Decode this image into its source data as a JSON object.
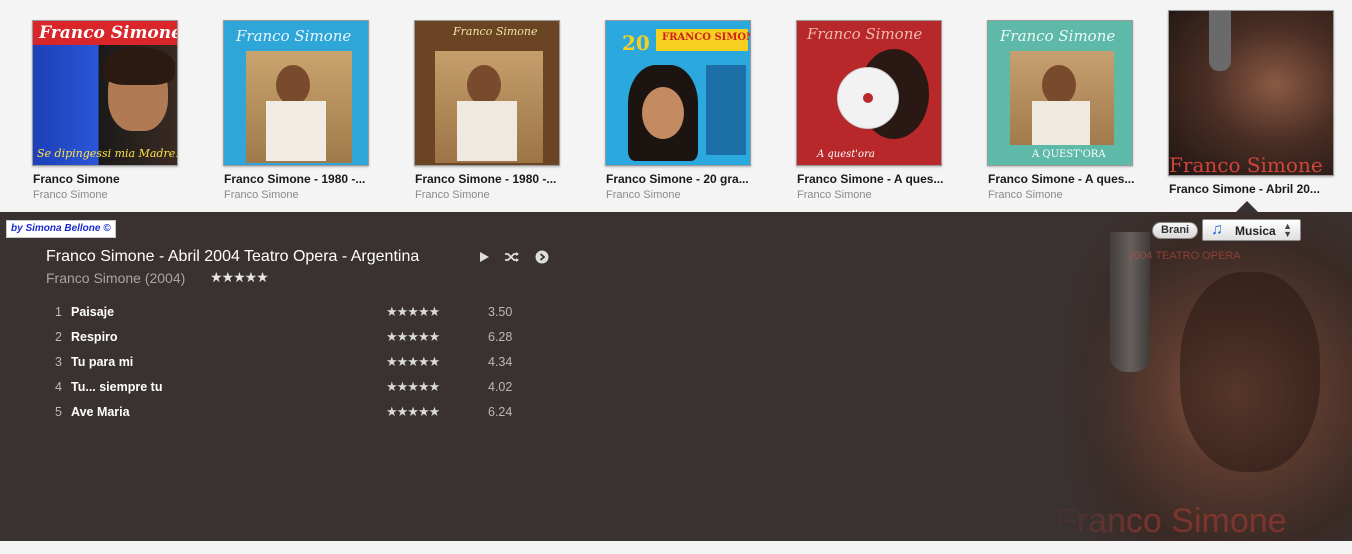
{
  "albums": [
    {
      "title": "Franco Simone",
      "artist": "Franco Simone",
      "cover_text": "Franco Simone",
      "cover_subtext": "Se dipingessi mia Madre..."
    },
    {
      "title": "Franco Simone - 1980 -...",
      "artist": "Franco Simone",
      "cover_text": "Franco Simone"
    },
    {
      "title": "Franco Simone - 1980 -...",
      "artist": "Franco Simone",
      "cover_text": "Franco Simone"
    },
    {
      "title": "Franco Simone - 20 gra...",
      "artist": "Franco Simone",
      "cover_text": "FRANCO SIMONE",
      "cover_badge": "20"
    },
    {
      "title": "Franco Simone - A ques...",
      "artist": "Franco Simone",
      "cover_text": "Franco Simone",
      "cover_subtext": "A quest'ora"
    },
    {
      "title": "Franco Simone - A ques...",
      "artist": "Franco Simone",
      "cover_text": "Franco Simone",
      "cover_subtext": "A QUEST'ORA"
    },
    {
      "title": "Franco Simone - Abril 20...",
      "artist": "",
      "cover_text": "Franco Simone"
    }
  ],
  "credit": "by Simona Bellone ©",
  "detail": {
    "title": "Franco Simone - Abril 2004 Teatro Opera - Argentina",
    "meta": "Franco Simone (2004)",
    "stars": "★★★★★",
    "play_icon": "play-icon",
    "shuffle_icon": "shuffle-icon",
    "more_icon": "more-icon"
  },
  "tracks": [
    {
      "num": "1",
      "name": "Paisaje",
      "stars": "★★★★★",
      "duration": "3.50"
    },
    {
      "num": "2",
      "name": "Respiro",
      "stars": "★★★★★",
      "duration": "6.28"
    },
    {
      "num": "3",
      "name": "Tu para mi",
      "stars": "★★★★★",
      "duration": "4.34"
    },
    {
      "num": "4",
      "name": "Tu... siempre tu",
      "stars": "★★★★★",
      "duration": "4.02"
    },
    {
      "num": "5",
      "name": "Ave Maria",
      "stars": "★★★★★",
      "duration": "6.24"
    }
  ],
  "view": {
    "brani_label": "Brani",
    "musica_label": "Musica",
    "musica_icon": "music-note-icon"
  },
  "bg_art": {
    "top_text": "2004  TEATRO OPERA",
    "bottom_text": "Franco Simone"
  },
  "colors": {
    "panel": "#3a3231",
    "accent": "#2a6fd1"
  }
}
